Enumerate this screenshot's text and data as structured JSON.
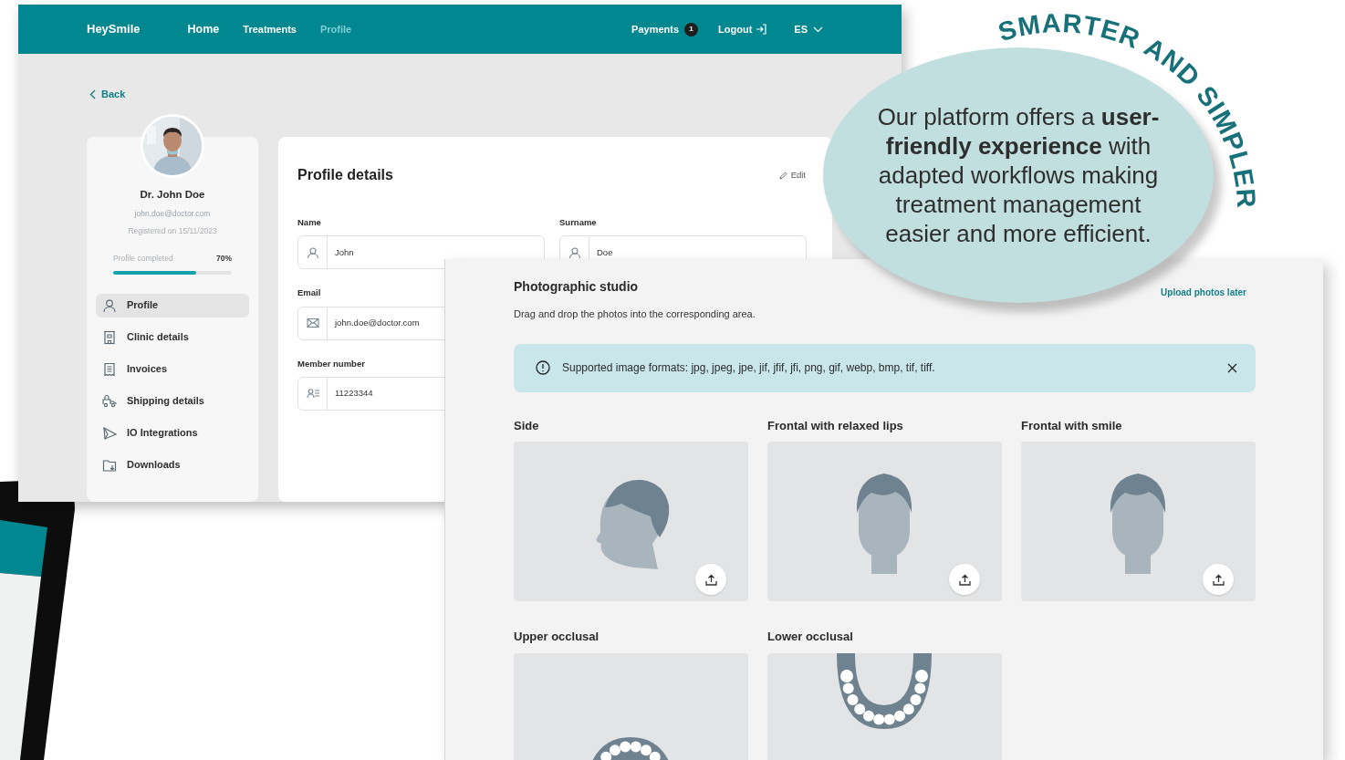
{
  "nav": {
    "logo": "HeySmile",
    "links": [
      {
        "label": "Home",
        "selected": false
      },
      {
        "label": "Treatments",
        "selected": false
      },
      {
        "label": "Profile",
        "selected": true
      }
    ],
    "payments": {
      "label": "Payments",
      "count": "1"
    },
    "logout": "Logout",
    "language": "ES"
  },
  "back": "Back",
  "profile_card": {
    "name": "Dr. John Doe",
    "email": "john.doe@doctor.com",
    "registered": "Registered on 15/11/2023",
    "progress_label": "Profile completed",
    "progress_reading": "70%",
    "level": 0.7
  },
  "menu": [
    {
      "label": "Profile",
      "selected": true
    },
    {
      "label": "Clinic details",
      "selected": false
    },
    {
      "label": "Invoices",
      "selected": false
    },
    {
      "label": "Shipping details",
      "selected": false
    },
    {
      "label": "IO Integrations",
      "selected": false
    },
    {
      "label": "Downloads",
      "selected": false
    }
  ],
  "profile_details": {
    "title": "Profile details",
    "edit": "Edit",
    "field_rows": [
      [
        {
          "label": "Name",
          "value": "John",
          "kind": "person"
        },
        {
          "label": "Surname",
          "value": "Doe",
          "kind": "person"
        }
      ],
      [
        {
          "label": "Email",
          "value": "john.doe@doctor.com",
          "kind": "mail"
        }
      ],
      [
        {
          "label": "Member number",
          "value": "11223344",
          "kind": "member"
        }
      ]
    ]
  },
  "studio": {
    "title": "Photographic studio",
    "subtitle": "Drag and drop the photos into the corresponding area.",
    "upload_later": "Upload photos later",
    "alert": "Supported image formats: jpg, jpeg, jpe, jif, jfif, jfi, png, gif, webp, bmp, tif, tiff.",
    "sections": [
      {
        "label": "Side",
        "kind": "side",
        "upload": true
      },
      {
        "label": "Frontal with relaxed lips",
        "kind": "frontal",
        "upload": true
      },
      {
        "label": "Frontal with smile",
        "kind": "frontal",
        "upload": true
      },
      {
        "label": "Upper occlusal",
        "kind": "upper"
      },
      {
        "label": "Lower occlusal",
        "kind": "lower"
      }
    ]
  },
  "bubble": {
    "arc_text": "SMARTER AND SIMPLER",
    "text": "Our platform offers a **user-friendly experience** with adapted workflows making treatment management easier and more efficient."
  }
}
